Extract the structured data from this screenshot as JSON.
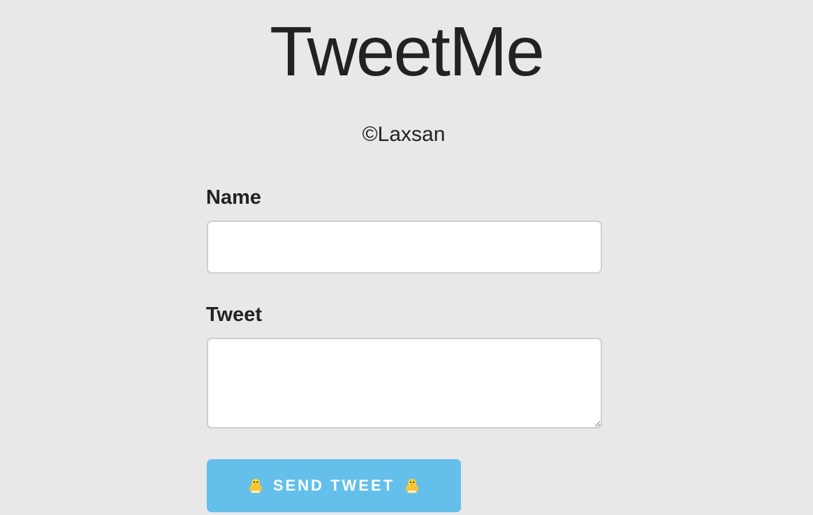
{
  "header": {
    "title": "TweetMe",
    "copyright": "©Laxsan"
  },
  "form": {
    "name_label": "Name",
    "name_value": "",
    "tweet_label": "Tweet",
    "tweet_value": "",
    "send_button": {
      "label": "SEND TWEET",
      "icon": "chick-icon",
      "color": "#64bfea"
    }
  },
  "colors": {
    "background": "#e8e8e8",
    "text": "#222222",
    "button": "#64bfea"
  }
}
